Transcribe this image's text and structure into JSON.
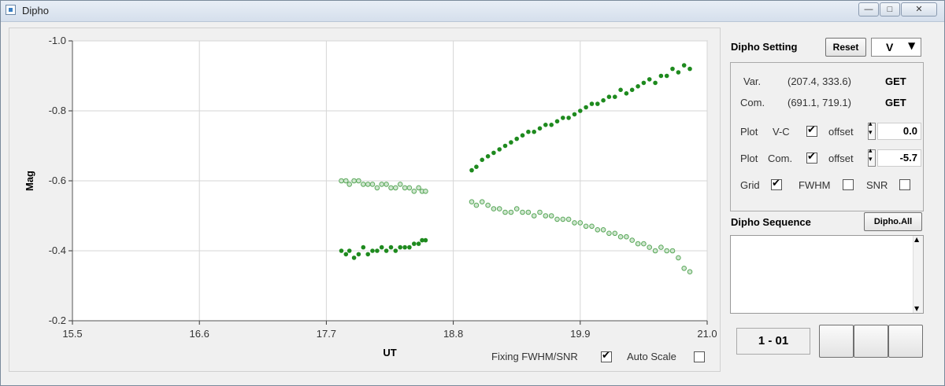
{
  "window": {
    "title": "Dipho",
    "controls": [
      "minimize-icon",
      "maximize-icon",
      "close-icon"
    ]
  },
  "plot": {
    "xlabel": "UT",
    "ylabel": "Mag",
    "fixing_label": "Fixing FWHM/SNR",
    "fixing_checked": true,
    "autoscale_label": "Auto Scale",
    "autoscale_checked": false
  },
  "chart_data": {
    "type": "scatter",
    "xlabel": "UT",
    "ylabel": "Mag",
    "xlim": [
      15.5,
      21.0
    ],
    "ylim": [
      -1.0,
      -0.2
    ],
    "y_inverted": true,
    "grid": true,
    "x_ticks": [
      "15.5",
      "16.6",
      "17.7",
      "18.8",
      "19.9",
      "21.0"
    ],
    "y_ticks": [
      "-1.0",
      "-0.8",
      "-0.6",
      "-0.4",
      "-0.2"
    ],
    "series": [
      {
        "color": "#1e8a1e",
        "marker": "filled",
        "x": [
          17.83,
          17.87,
          17.9,
          17.94,
          17.98,
          18.02,
          18.06,
          18.1,
          18.14,
          18.18,
          18.22,
          18.26,
          18.3,
          18.34,
          18.38,
          18.42,
          18.46,
          18.5,
          18.53,
          18.56,
          18.96,
          19.0,
          19.05,
          19.1,
          19.15,
          19.2,
          19.25,
          19.3,
          19.35,
          19.4,
          19.45,
          19.5,
          19.55,
          19.6,
          19.65,
          19.7,
          19.75,
          19.8,
          19.85,
          19.9,
          19.95,
          20.0,
          20.05,
          20.1,
          20.15,
          20.2,
          20.25,
          20.3,
          20.35,
          20.4,
          20.45,
          20.5,
          20.55,
          20.6,
          20.65,
          20.7,
          20.75,
          20.8,
          20.85
        ],
        "y": [
          -0.4,
          -0.39,
          -0.4,
          -0.38,
          -0.39,
          -0.41,
          -0.39,
          -0.4,
          -0.4,
          -0.41,
          -0.4,
          -0.41,
          -0.4,
          -0.41,
          -0.41,
          -0.41,
          -0.42,
          -0.42,
          -0.43,
          -0.43,
          -0.63,
          -0.64,
          -0.66,
          -0.67,
          -0.68,
          -0.69,
          -0.7,
          -0.71,
          -0.72,
          -0.73,
          -0.74,
          -0.74,
          -0.75,
          -0.76,
          -0.76,
          -0.77,
          -0.78,
          -0.78,
          -0.79,
          -0.8,
          -0.81,
          -0.82,
          -0.82,
          -0.83,
          -0.84,
          -0.84,
          -0.86,
          -0.85,
          -0.86,
          -0.87,
          -0.88,
          -0.89,
          -0.88,
          -0.9,
          -0.9,
          -0.92,
          -0.91,
          -0.93,
          -0.92
        ]
      },
      {
        "color": "#5aa85a",
        "marker": "hollow",
        "x": [
          17.83,
          17.87,
          17.9,
          17.94,
          17.98,
          18.02,
          18.06,
          18.1,
          18.14,
          18.18,
          18.22,
          18.26,
          18.3,
          18.34,
          18.38,
          18.42,
          18.46,
          18.5,
          18.53,
          18.56,
          18.96,
          19.0,
          19.05,
          19.1,
          19.15,
          19.2,
          19.25,
          19.3,
          19.35,
          19.4,
          19.45,
          19.5,
          19.55,
          19.6,
          19.65,
          19.7,
          19.75,
          19.8,
          19.85,
          19.9,
          19.95,
          20.0,
          20.05,
          20.1,
          20.15,
          20.2,
          20.25,
          20.3,
          20.35,
          20.4,
          20.45,
          20.5,
          20.55,
          20.6,
          20.65,
          20.7,
          20.75,
          20.8,
          20.85
        ],
        "y": [
          -0.6,
          -0.6,
          -0.59,
          -0.6,
          -0.6,
          -0.59,
          -0.59,
          -0.59,
          -0.58,
          -0.59,
          -0.59,
          -0.58,
          -0.58,
          -0.59,
          -0.58,
          -0.58,
          -0.57,
          -0.58,
          -0.57,
          -0.57,
          -0.54,
          -0.53,
          -0.54,
          -0.53,
          -0.52,
          -0.52,
          -0.51,
          -0.51,
          -0.52,
          -0.51,
          -0.51,
          -0.5,
          -0.51,
          -0.5,
          -0.5,
          -0.49,
          -0.49,
          -0.49,
          -0.48,
          -0.48,
          -0.47,
          -0.47,
          -0.46,
          -0.46,
          -0.45,
          -0.45,
          -0.44,
          -0.44,
          -0.43,
          -0.42,
          -0.42,
          -0.41,
          -0.4,
          -0.41,
          -0.4,
          -0.4,
          -0.38,
          -0.35,
          -0.34
        ]
      }
    ]
  },
  "settings": {
    "title": "Dipho Setting",
    "reset_label": "Reset",
    "filter_value": "V",
    "var_label": "Var.",
    "var_coords": "(207.4, 333.6)",
    "var_get": "GET",
    "com_label": "Com.",
    "com_coords": "(691.1, 719.1)",
    "com_get": "GET",
    "plot_label": "Plot",
    "vc_label": "V-C",
    "vc_checked": true,
    "vc_offset_label": "offset",
    "vc_offset": "0.0",
    "com_plot_label": "Com.",
    "com_checked": true,
    "com_offset_label": "offset",
    "com_offset": "-5.7",
    "grid_label": "Grid",
    "grid_checked": true,
    "fwhm_label": "FWHM",
    "fwhm_checked": false,
    "snr_label": "SNR",
    "snr_checked": false
  },
  "sequence": {
    "title": "Dipho Sequence",
    "all_label": "Dipho.All",
    "counter": "1 - 01"
  }
}
